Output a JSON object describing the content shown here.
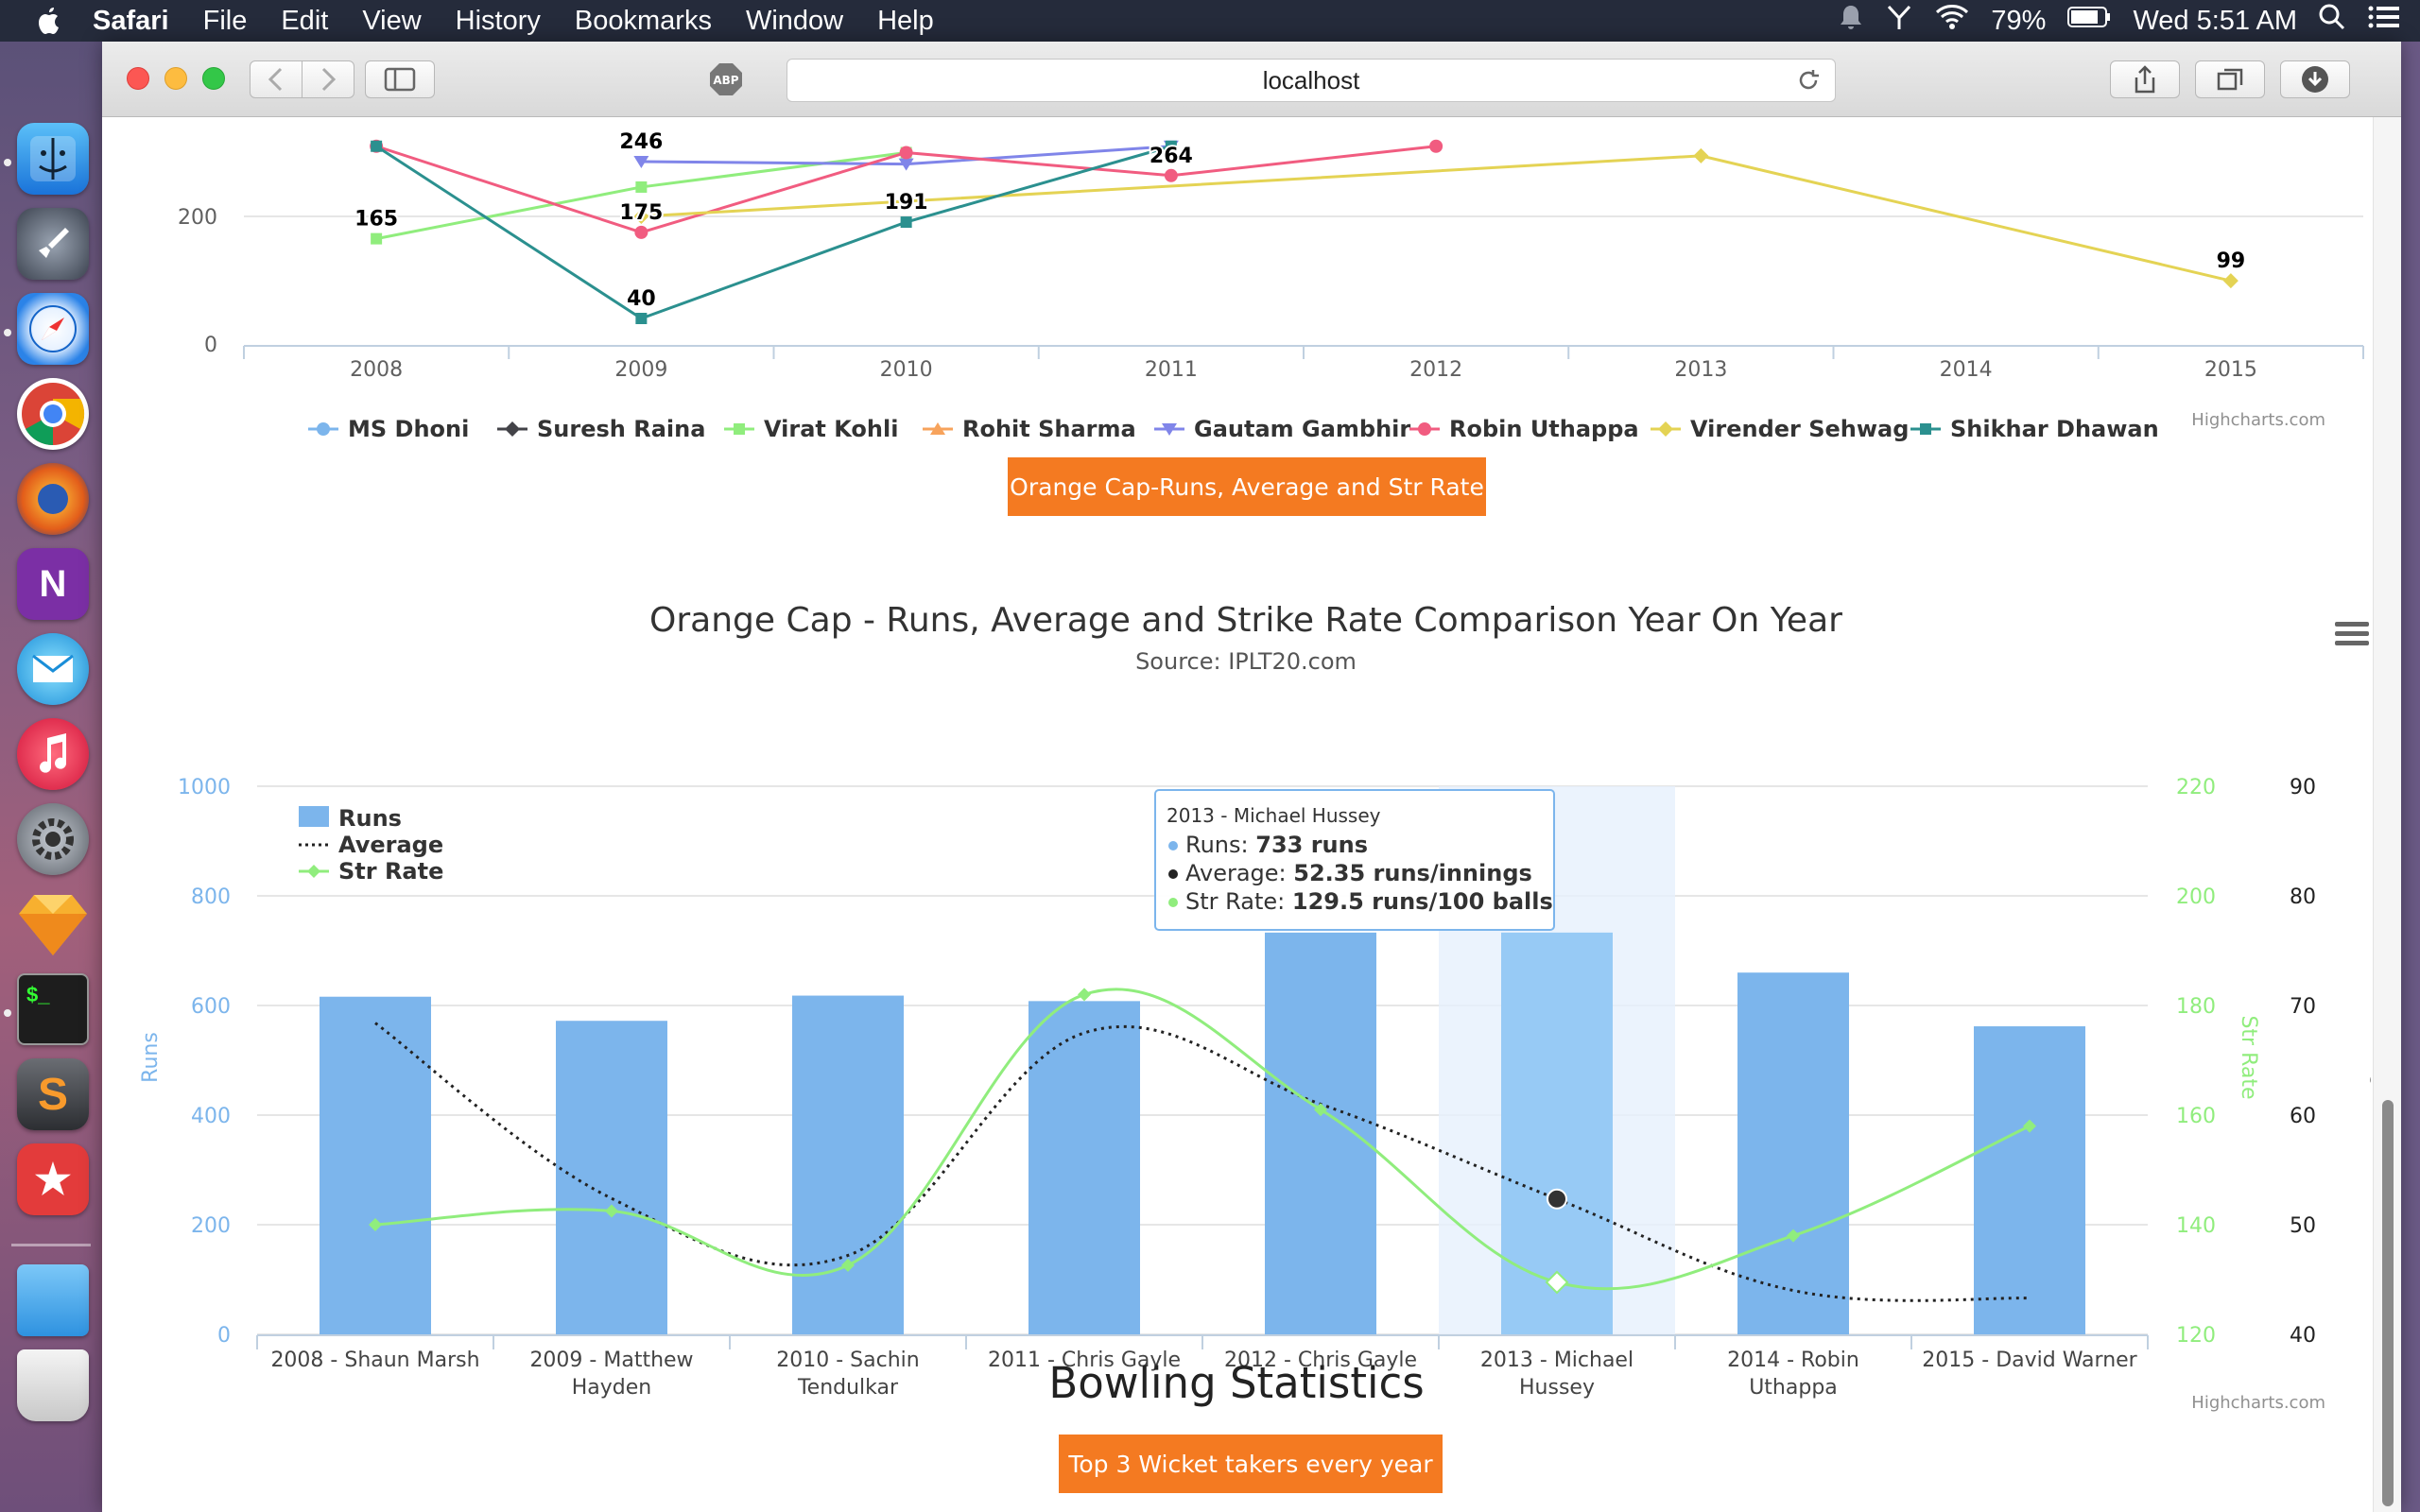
{
  "menubar": {
    "app": "Safari",
    "items": [
      "File",
      "Edit",
      "View",
      "History",
      "Bookmarks",
      "Window",
      "Help"
    ],
    "battery": "79%",
    "clock": "Wed 5:51 AM"
  },
  "browser": {
    "url": "localhost",
    "adblock": "ABP"
  },
  "top_chart": {
    "credit": "Highcharts.com",
    "chart_data": {
      "type": "line",
      "x": [
        "2008",
        "2009",
        "2010",
        "2011",
        "2012",
        "2013",
        "2014",
        "2015"
      ],
      "y_ticks": [
        "0",
        "200"
      ],
      "ylim": [
        0,
        500
      ],
      "series": [
        {
          "name": "MS Dhoni",
          "color": "#7cb5ec",
          "values": [
            null,
            null,
            null,
            null,
            null,
            null,
            null,
            null
          ]
        },
        {
          "name": "Suresh Raina",
          "color": "#434348",
          "values": [
            null,
            null,
            null,
            null,
            null,
            null,
            null,
            null
          ]
        },
        {
          "name": "Virat Kohli",
          "color": "#90ed7d",
          "values": [
            165,
            246,
            300,
            null,
            null,
            null,
            null,
            null
          ]
        },
        {
          "name": "Rohit Sharma",
          "color": "#f7a35c",
          "values": [
            null,
            null,
            null,
            null,
            null,
            null,
            null,
            null
          ]
        },
        {
          "name": "Gautam Gambhir",
          "color": "#8085e9",
          "values": [
            null,
            286,
            282,
            310,
            null,
            null,
            null,
            null
          ]
        },
        {
          "name": "Robin Uthappa",
          "color": "#f15c80",
          "values": [
            310,
            175,
            300,
            264,
            310,
            null,
            null,
            null
          ]
        },
        {
          "name": "Virender Sehwag",
          "color": "#e4d354",
          "values": [
            null,
            200,
            null,
            null,
            null,
            295,
            null,
            99
          ]
        },
        {
          "name": "Shikhar Dhawan",
          "color": "#2b908f",
          "values": [
            310,
            40,
            191,
            310,
            null,
            null,
            null,
            null
          ]
        }
      ],
      "data_labels": [
        {
          "series": "Virat Kohli",
          "x": "2008",
          "value": 165,
          "label": "165"
        },
        {
          "series": "Gautam Gambhir",
          "x": "2009",
          "value": 286,
          "label": "246"
        },
        {
          "series": "Robin Uthappa",
          "x": "2009",
          "value": 175,
          "label": "175"
        },
        {
          "series": "Shikhar Dhawan",
          "x": "2009",
          "value": 40,
          "label": "40"
        },
        {
          "series": "Shikhar Dhawan",
          "x": "2010",
          "value": 191,
          "label": "191"
        },
        {
          "series": "Robin Uthappa",
          "x": "2011",
          "value": 264,
          "label": "264"
        },
        {
          "series": "Virender Sehwag",
          "x": "2015",
          "value": 99,
          "label": "99"
        }
      ]
    }
  },
  "buttons": {
    "orange_cap": "Orange Cap-Runs, Average and Str Rate",
    "wickets": "Top 3 Wicket takers every year"
  },
  "bowling": {
    "title": "Bowling Statistics"
  },
  "main_chart": {
    "credit": "Highcharts.com",
    "chart_data": {
      "type": "bar",
      "title": "Orange Cap - Runs, Average and Strike Rate Comparison Year On Year",
      "subtitle": "Source: IPLT20.com",
      "categories": [
        [
          "2008 - Shaun Marsh"
        ],
        [
          "2009 - Matthew",
          "Hayden"
        ],
        [
          "2010 - Sachin",
          "Tendulkar"
        ],
        [
          "2011 - Chris Gayle"
        ],
        [
          "2012 - Chris Gayle"
        ],
        [
          "2013 - Michael",
          "Hussey"
        ],
        [
          "2014 - Robin",
          "Uthappa"
        ],
        [
          "2015 - David Warner"
        ]
      ],
      "axes": {
        "runs": {
          "label": "Runs",
          "min": 0,
          "max": 1000,
          "ticks": [
            "0",
            "200",
            "400",
            "600",
            "800",
            "1000"
          ],
          "color": "#7cb5ec"
        },
        "str_rate": {
          "label": "Str Rate",
          "min": 120,
          "max": 220,
          "ticks": [
            "120",
            "140",
            "160",
            "180",
            "200",
            "220"
          ],
          "color": "#90ed7d"
        },
        "average": {
          "label": "Average",
          "min": 40,
          "max": 90,
          "ticks": [
            "40",
            "50",
            "60",
            "70",
            "80",
            "90"
          ],
          "color": "#222222"
        }
      },
      "series": [
        {
          "name": "Runs",
          "kind": "column",
          "color": "#7cb5ec",
          "values": [
            616,
            572,
            618,
            608,
            733,
            733,
            660,
            562
          ]
        },
        {
          "name": "Average",
          "kind": "spline-dotted",
          "color": "#222222",
          "values": [
            68.4,
            52.4,
            47.2,
            67.5,
            61.0,
            52.35,
            44.0,
            43.3
          ]
        },
        {
          "name": "Str Rate",
          "kind": "spline",
          "color": "#90ed7d",
          "values": [
            140.0,
            142.5,
            132.6,
            182.0,
            161.0,
            129.5,
            138.0,
            158.0
          ]
        }
      ],
      "legend_position": "top-left",
      "highlighted_index": 5,
      "tooltip": {
        "header": "2013 - Michael Hussey",
        "rows": [
          {
            "label": "Runs: ",
            "value": "733 runs",
            "color": "#7cb5ec"
          },
          {
            "label": "Average: ",
            "value": "52.35 runs/innings",
            "color": "#222222"
          },
          {
            "label": "Str Rate: ",
            "value": "129.5 runs/100 balls",
            "color": "#90ed7d"
          }
        ]
      }
    }
  }
}
